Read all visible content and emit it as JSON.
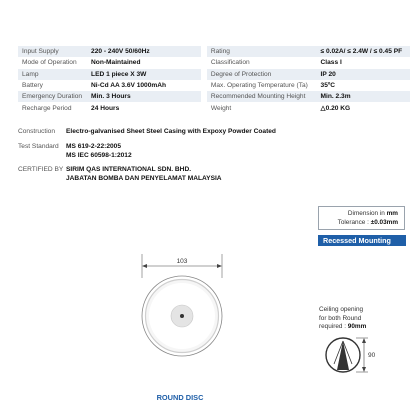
{
  "specs": {
    "left": [
      {
        "label": "Input Supply",
        "value": "220 - 240V 50/60Hz"
      },
      {
        "label": "Mode of Operation",
        "value": "Non-Maintained"
      },
      {
        "label": "Lamp",
        "value": "LED 1 piece X 3W"
      },
      {
        "label": "Battery",
        "value": "Ni-Cd AA 3.6V 1000mAh"
      },
      {
        "label": "Emergency Duration",
        "value": "Min. 3 Hours"
      },
      {
        "label": "Recharge Period",
        "value": "24 Hours"
      }
    ],
    "right": [
      {
        "label": "Rating",
        "value": "≤ 0.02A/ ≤ 2.4W / ≤ 0.45 PF"
      },
      {
        "label": "Classification",
        "value": "Class I"
      },
      {
        "label": "Degree of Protection",
        "value": "IP 20"
      },
      {
        "label": "Max. Operating Temperature (Ta)",
        "value": "35ºC"
      },
      {
        "label": "Recommended Mounting Height",
        "value": "Min. 2.3m"
      },
      {
        "label": "Weight",
        "value": "△0.20 KG"
      }
    ]
  },
  "construction": {
    "label": "Construction",
    "value": "Electro-galvanised Sheet Steel Casing with Expoxy Powder Coated"
  },
  "test_standard": {
    "label": "Test Standard",
    "values": [
      "MS 619-2-22:2005",
      "MS IEC 60598-1:2012"
    ]
  },
  "certified_by": {
    "label": "CERTIFIED BY",
    "values": [
      "SIRIM QAS INTERNATIONAL SDN. BHD.",
      "JABATAN BOMBA DAN PENYELAMAT MALAYSIA"
    ]
  },
  "dimension_note": {
    "line1_prefix": "Dimension in ",
    "line1_unit": "mm",
    "line2_prefix": "Tolerance : ",
    "line2_value": "±0.03mm"
  },
  "mounting": {
    "label": "Recessed Mounting"
  },
  "drawing": {
    "diameter_label": "103",
    "product_label": "ROUND DISC"
  },
  "ceiling_opening": {
    "line1": "Ceiling opening",
    "line2": "for both Round",
    "line3_prefix": "required : ",
    "line3_value": "90mm",
    "dimension_label": "90"
  },
  "colors": {
    "accent": "#1f5fa8",
    "row_shade": "#e9eef4"
  }
}
